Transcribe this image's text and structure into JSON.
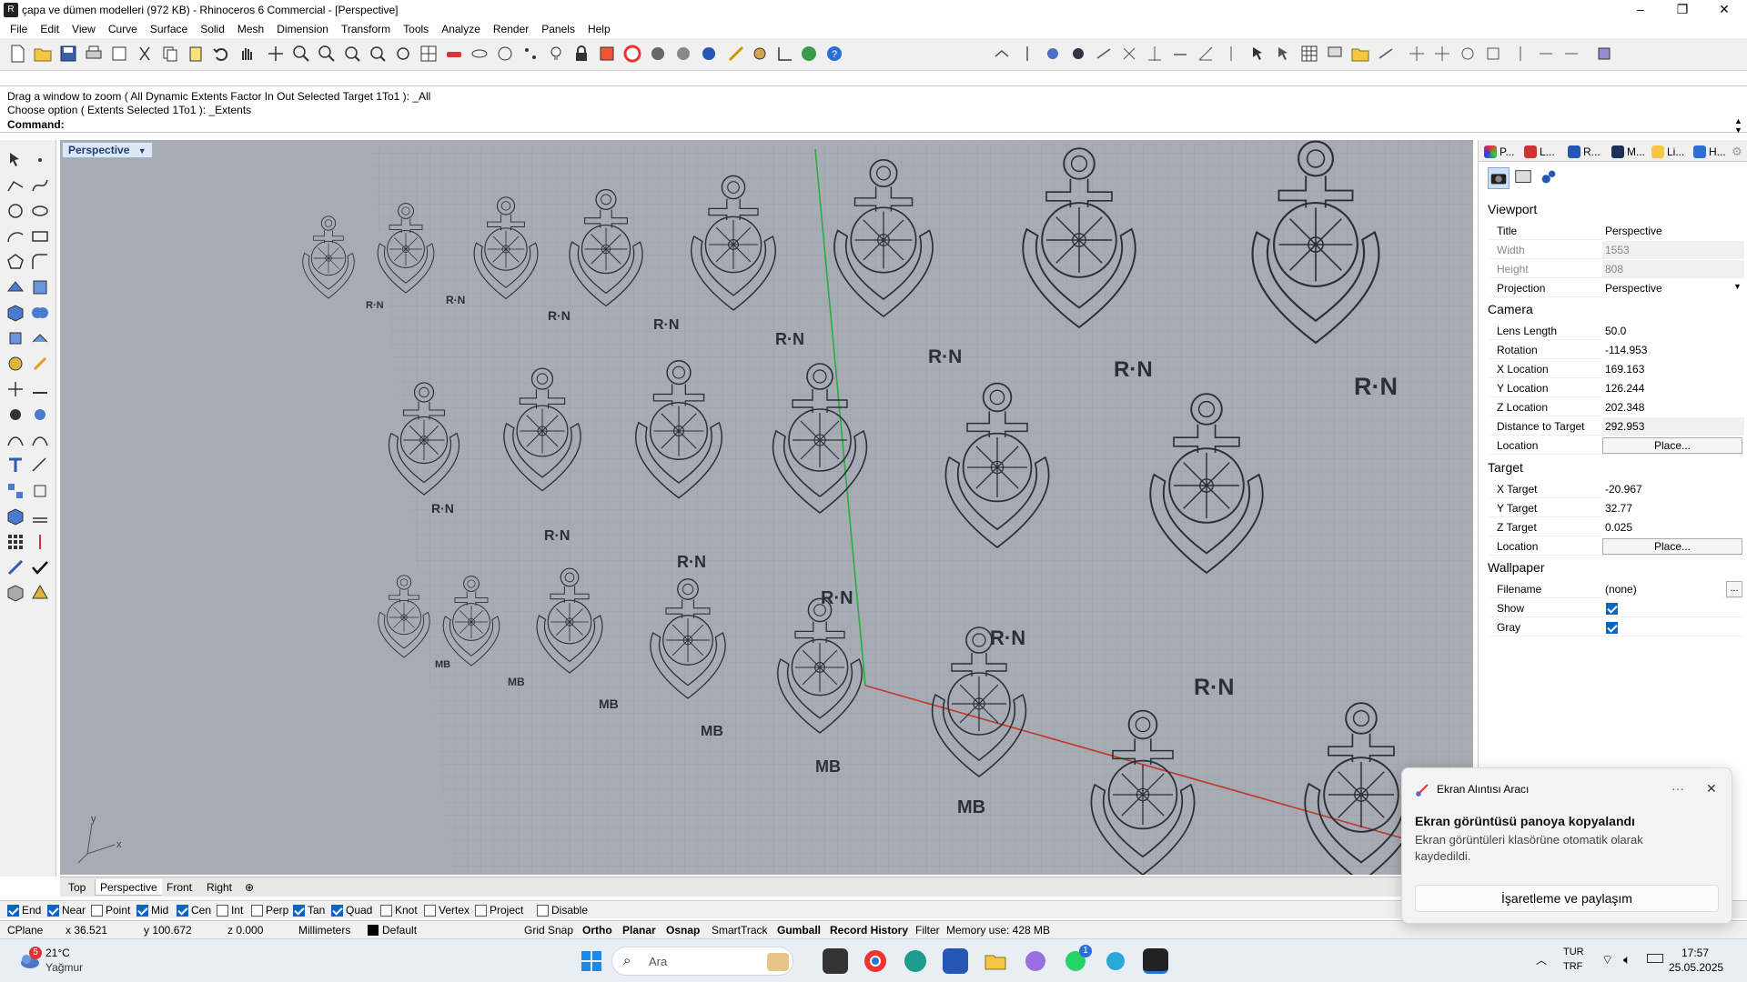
{
  "window": {
    "title": "çapa ve dümen modelleri (972 KB) - Rhinoceros 6 Commercial - [Perspective]",
    "minimize": "–",
    "maximize": "❐",
    "close": "✕"
  },
  "menu": [
    "File",
    "Edit",
    "View",
    "Curve",
    "Surface",
    "Solid",
    "Mesh",
    "Dimension",
    "Transform",
    "Tools",
    "Analyze",
    "Render",
    "Panels",
    "Help"
  ],
  "command": {
    "history1": "Drag a window to zoom ( All  Dynamic  Extents  Factor  In  Out  Selected  Target  1To1 ): _All",
    "history2": "Choose option ( Extents  Selected  1To1 ): _Extents",
    "prompt_label": "Command:",
    "value": ""
  },
  "viewport": {
    "label": "Perspective",
    "models_rn": "R·N",
    "models_mb": "MB",
    "axis_x": "x",
    "axis_y": "y"
  },
  "view_tabs": [
    "Top",
    "Perspective",
    "Front",
    "Right"
  ],
  "view_tabs_active": "Perspective",
  "osnaps": [
    {
      "label": "End",
      "checked": true
    },
    {
      "label": "Near",
      "checked": true
    },
    {
      "label": "Point",
      "checked": false
    },
    {
      "label": "Mid",
      "checked": true
    },
    {
      "label": "Cen",
      "checked": true
    },
    {
      "label": "Int",
      "checked": false
    },
    {
      "label": "Perp",
      "checked": false
    },
    {
      "label": "Tan",
      "checked": true
    },
    {
      "label": "Quad",
      "checked": true
    },
    {
      "label": "Knot",
      "checked": false
    },
    {
      "label": "Vertex",
      "checked": false
    },
    {
      "label": "Project",
      "checked": false
    },
    {
      "label": "Disable",
      "checked": false
    }
  ],
  "status": {
    "cplane": "CPlane",
    "x": "x 36.521",
    "y": "y 100.672",
    "z": "z 0.000",
    "units": "Millimeters",
    "layer": "Default",
    "grid_snap": "Grid Snap",
    "ortho": "Ortho",
    "planar": "Planar",
    "osnap": "Osnap",
    "smarttrack": "SmartTrack",
    "gumball": "Gumball",
    "record_history": "Record History",
    "filter": "Filter",
    "memory": "Memory use: 428 MB"
  },
  "panel": {
    "tabs": [
      "P...",
      "L...",
      "R...",
      "M...",
      "Li...",
      "H..."
    ],
    "sections": {
      "viewport": "Viewport",
      "camera": "Camera",
      "target": "Target",
      "wallpaper": "Wallpaper"
    },
    "viewport_props": {
      "title_label": "Title",
      "title_value": "Perspective",
      "width_label": "Width",
      "width_value": "1553",
      "height_label": "Height",
      "height_value": "808",
      "projection_label": "Projection",
      "projection_value": "Perspective"
    },
    "camera_props": {
      "lens_label": "Lens Length",
      "lens_value": "50.0",
      "rotation_label": "Rotation",
      "rotation_value": "-114.953",
      "xloc_label": "X Location",
      "xloc_value": "169.163",
      "yloc_label": "Y Location",
      "yloc_value": "126.244",
      "zloc_label": "Z Location",
      "zloc_value": "202.348",
      "dist_label": "Distance to Target",
      "dist_value": "292.953",
      "location_label": "Location",
      "location_button": "Place..."
    },
    "target_props": {
      "x_label": "X Target",
      "x_value": "-20.967",
      "y_label": "Y Target",
      "y_value": "32.77",
      "z_label": "Z Target",
      "z_value": "0.025",
      "location_label": "Location",
      "location_button": "Place..."
    },
    "wallpaper_props": {
      "filename_label": "Filename",
      "filename_value": "(none)",
      "filename_button": "...",
      "show_label": "Show",
      "show_checked": true,
      "gray_label": "Gray",
      "gray_checked": true
    }
  },
  "toast": {
    "app": "Ekran Alıntısı Aracı",
    "more": "···",
    "close": "✕",
    "heading": "Ekran görüntüsü panoya kopyalandı",
    "body": "Ekran görüntüleri klasörüne otomatik olarak kaydedildi.",
    "action": "İşaretleme ve paylaşım"
  },
  "taskbar": {
    "weather_temp": "21°C",
    "weather_desc": "Yağmur",
    "weather_badge": "5",
    "search_placeholder": "Ara",
    "lang1": "TUR",
    "lang2": "TRF",
    "time": "17:57",
    "date": "25.05.2025",
    "whatsapp_badge": "1"
  },
  "colors": {
    "viewport_bg": "#a7acb4",
    "grid": "#8d939c",
    "x_axis": "#c0392b",
    "y_axis": "#27ae40",
    "accent": "#0a64c8"
  }
}
